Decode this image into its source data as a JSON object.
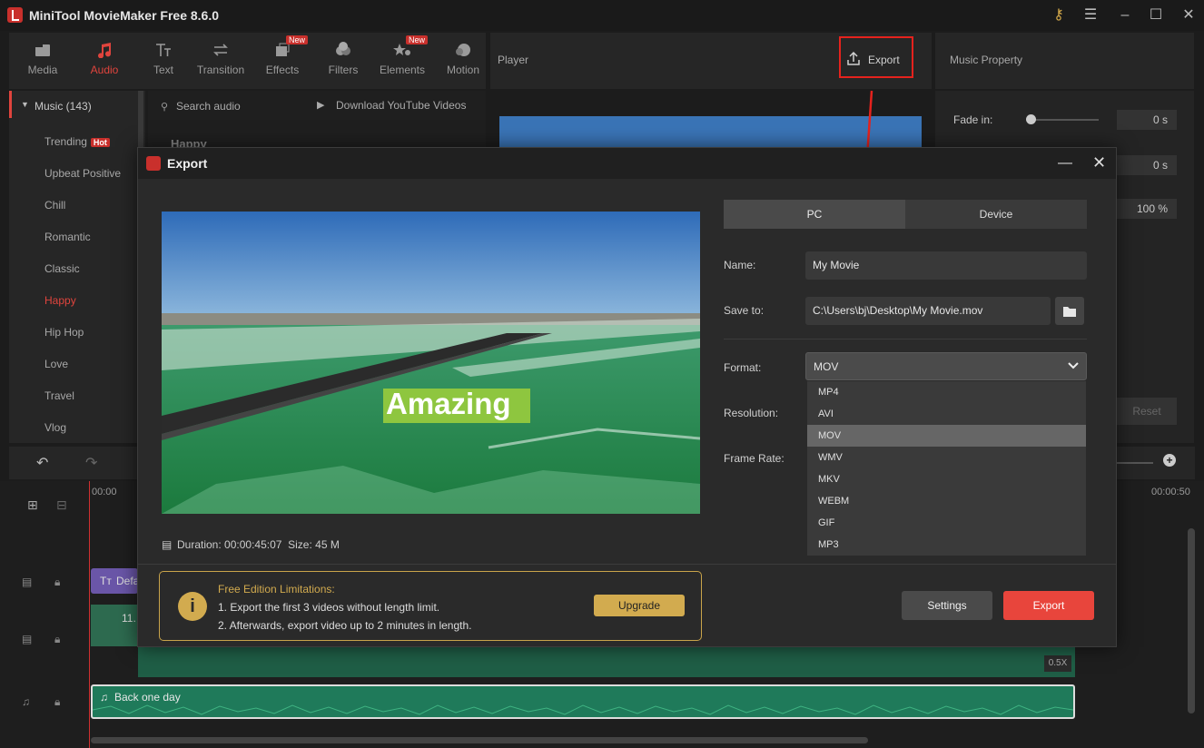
{
  "window": {
    "title": "MiniTool MovieMaker Free 8.6.0"
  },
  "toolbar": {
    "tabs": [
      {
        "label": "Media",
        "icon": "media-icon"
      },
      {
        "label": "Audio",
        "icon": "music-note-icon"
      },
      {
        "label": "Text",
        "icon": "text-icon"
      },
      {
        "label": "Transition",
        "icon": "transition-icon"
      },
      {
        "label": "Effects",
        "icon": "effects-icon",
        "badge": "New"
      },
      {
        "label": "Filters",
        "icon": "filters-icon"
      },
      {
        "label": "Elements",
        "icon": "elements-icon",
        "badge": "New"
      },
      {
        "label": "Motion",
        "icon": "motion-icon"
      }
    ]
  },
  "player": {
    "label": "Player",
    "export_label": "Export"
  },
  "music_property": {
    "label": "Music Property",
    "fade_in_label": "Fade in:",
    "fade_in_value": "0 s",
    "fade_out_value": "0 s",
    "volume_value": "100 %",
    "reset_label": "Reset"
  },
  "sidebar": {
    "header": "Music (143)",
    "items": [
      {
        "label": "Trending",
        "badge": "Hot"
      },
      {
        "label": "Upbeat Positive"
      },
      {
        "label": "Chill"
      },
      {
        "label": "Romantic"
      },
      {
        "label": "Classic"
      },
      {
        "label": "Happy",
        "active": true
      },
      {
        "label": "Hip Hop"
      },
      {
        "label": "Love"
      },
      {
        "label": "Travel"
      },
      {
        "label": "Vlog"
      }
    ]
  },
  "library": {
    "search_placeholder": "Search audio",
    "download_label": "Download YouTube Videos",
    "section_title": "Happy"
  },
  "export_dialog": {
    "title": "Export",
    "preview_text": "Amazing",
    "duration_label": "Duration:",
    "duration_value": "00:00:45:07",
    "size_label": "Size:",
    "size_value": "45 M",
    "tabs": [
      "PC",
      "Device"
    ],
    "name_label": "Name:",
    "name_value": "My Movie",
    "save_label": "Save to:",
    "save_value": "C:\\Users\\bj\\Desktop\\My Movie.mov",
    "format_label": "Format:",
    "format_value": "MOV",
    "resolution_label": "Resolution:",
    "frame_rate_label": "Frame Rate:",
    "format_options": [
      "MP4",
      "AVI",
      "MOV",
      "WMV",
      "MKV",
      "WEBM",
      "GIF",
      "MP3"
    ],
    "selected_index": 2,
    "limit_title": "Free Edition Limitations:",
    "limit_line1": "1. Export the first 3 videos without length limit.",
    "limit_line2": "2. Afterwards, export video up to 2 minutes in length.",
    "upgrade_label": "Upgrade",
    "settings_label": "Settings",
    "export_label": "Export"
  },
  "timeline": {
    "time_start": "00:00",
    "time_end": "00:00:50",
    "text_clip": "Defa",
    "video_clip": "11.",
    "speed": "0.5X",
    "audio_clip": "Back one day"
  },
  "colors": {
    "accent": "#e0443d",
    "export_button": "#e8453c",
    "upgrade": "#d2ab4f",
    "warning_border": "#c9a44a"
  }
}
